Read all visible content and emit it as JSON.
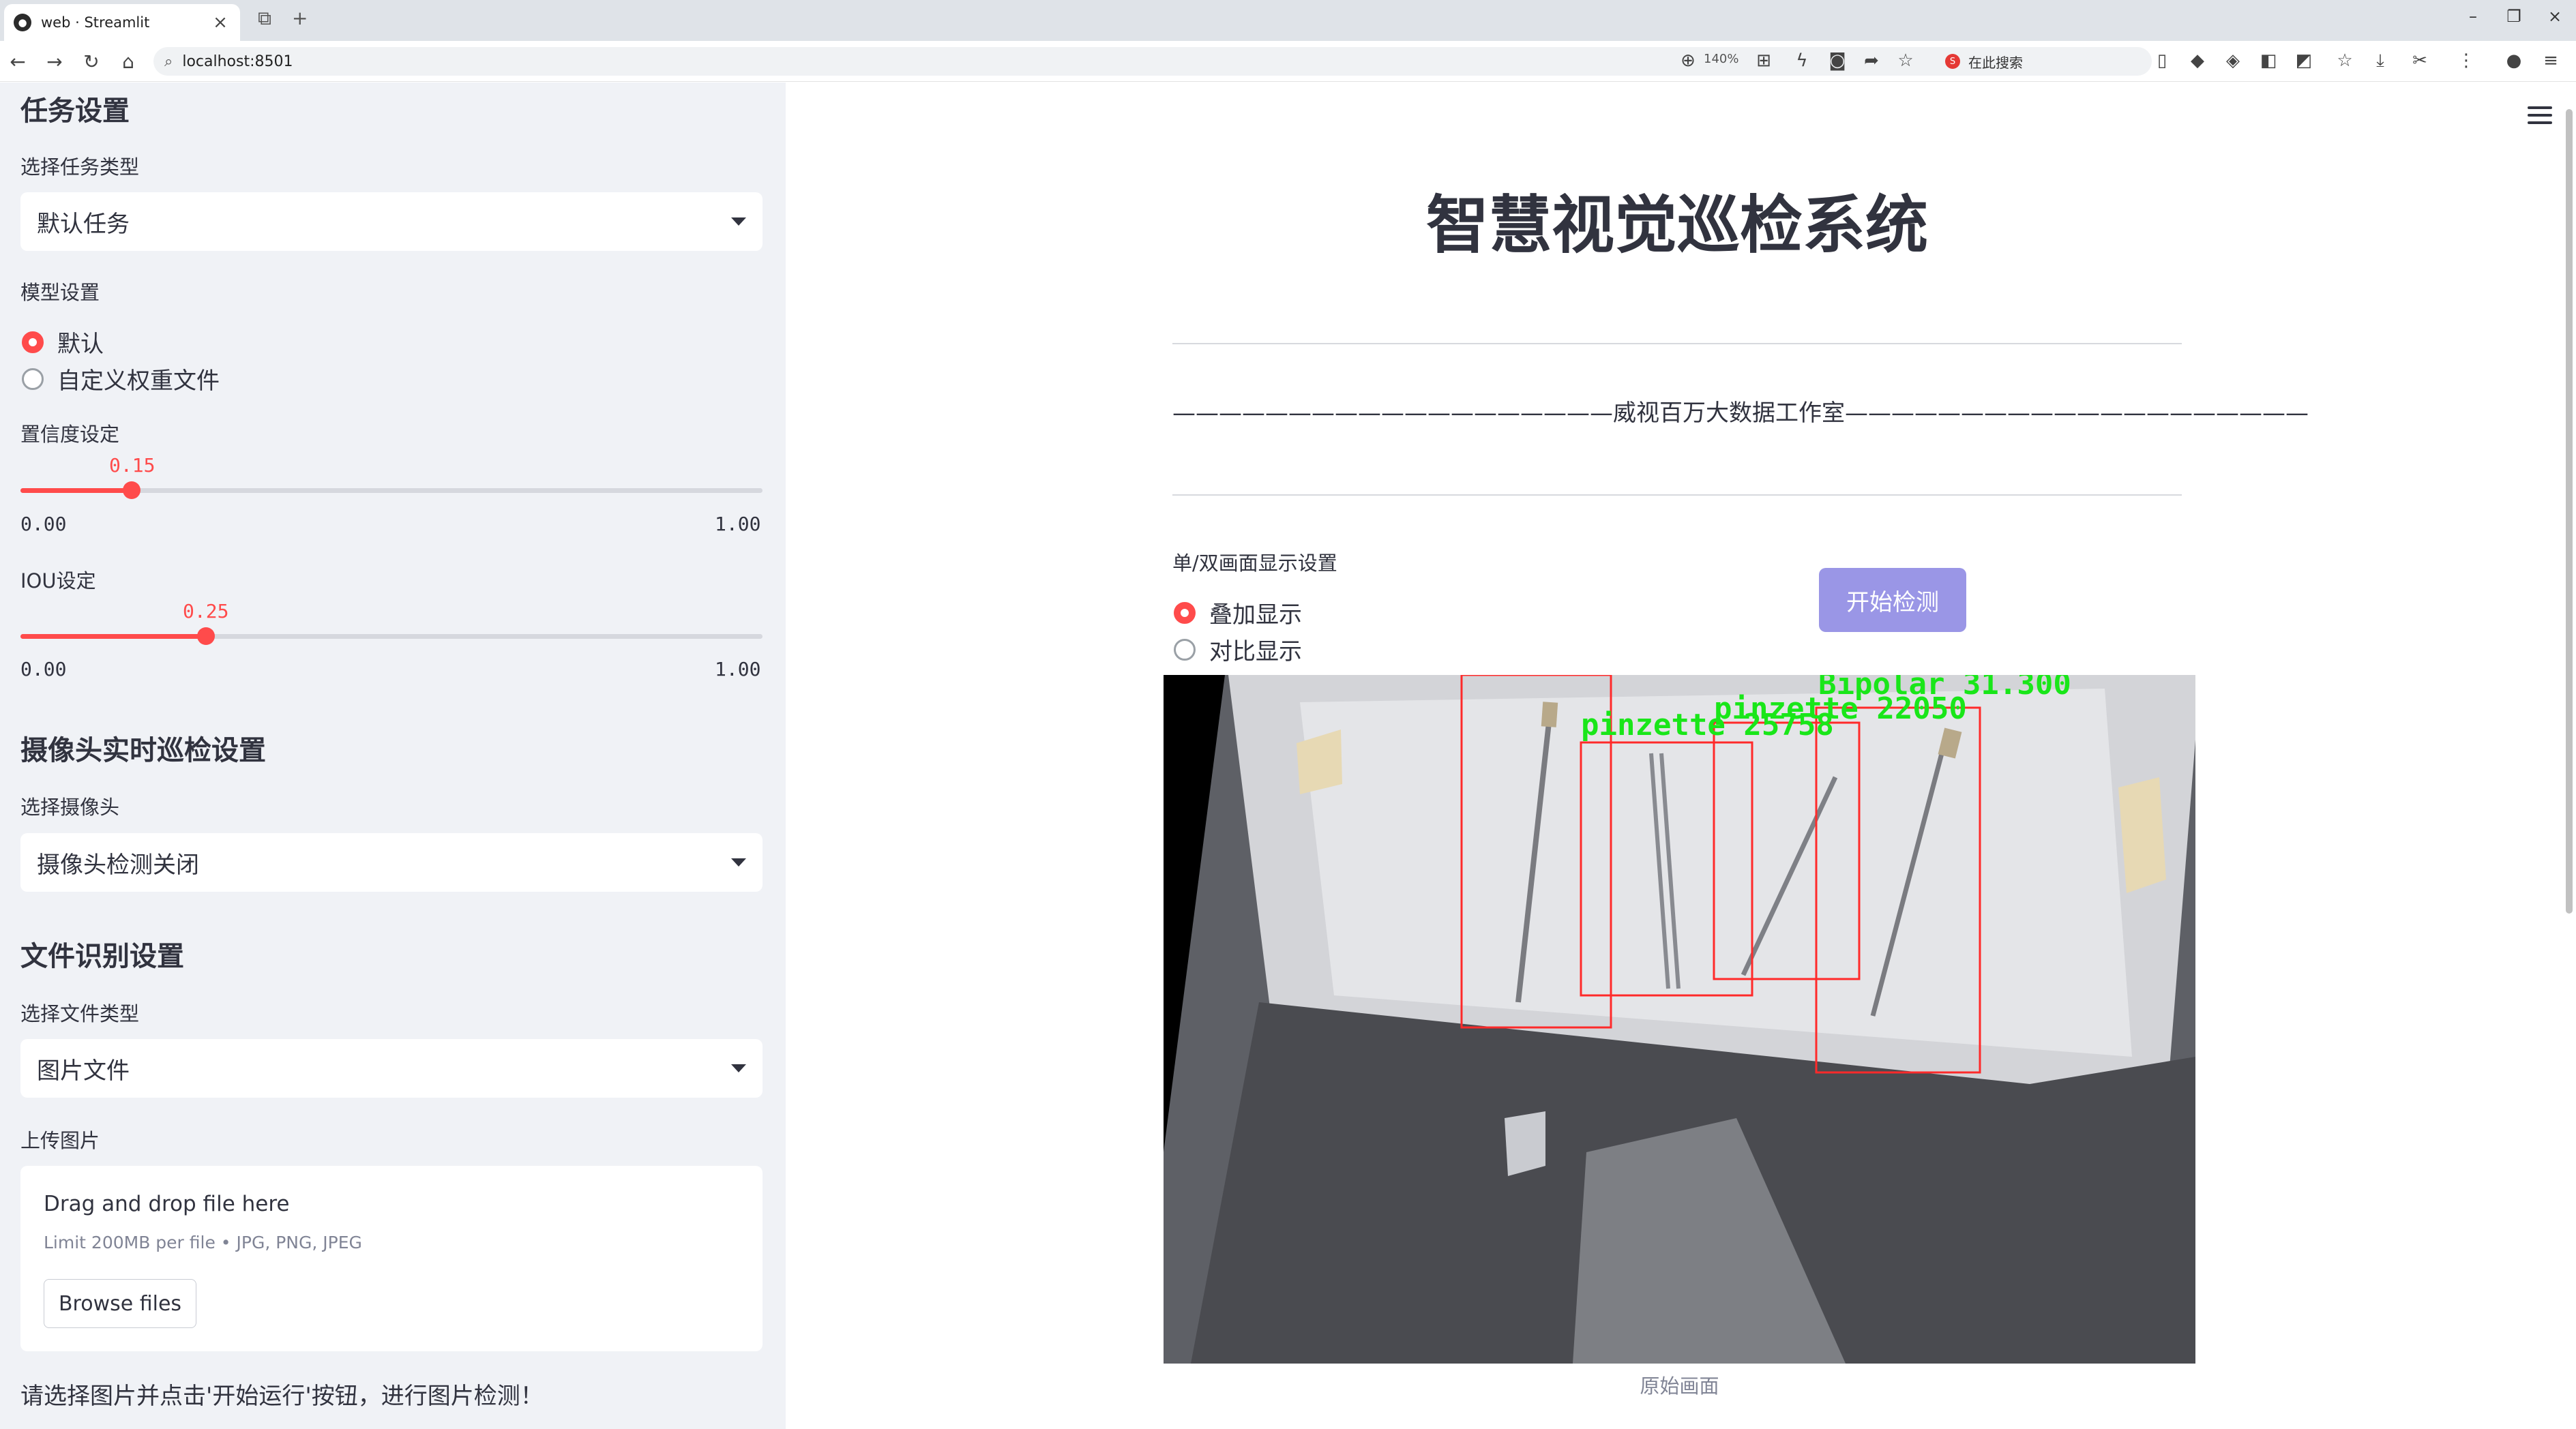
{
  "browser": {
    "tab_title": "web · Streamlit",
    "favicon_glyph": "●",
    "url": "localhost:8501",
    "zoom": "140%",
    "search_placeholder": "在此搜索",
    "search_engine_glyph": "S"
  },
  "sidebar": {
    "task_section": {
      "heading": "任务设置",
      "task_type_label": "选择任务类型",
      "task_type_value": "默认任务",
      "model_label": "模型设置",
      "model_options": [
        "默认",
        "自定义权重文件"
      ],
      "model_selected": 0
    },
    "confidence": {
      "label": "置信度设定",
      "value": "0.15",
      "value_num": 0.15,
      "min": "0.00",
      "max": "1.00"
    },
    "iou": {
      "label": "IOU设定",
      "value": "0.25",
      "value_num": 0.25,
      "min": "0.00",
      "max": "1.00"
    },
    "camera_section": {
      "heading": "摄像头实时巡检设置",
      "camera_label": "选择摄像头",
      "camera_value": "摄像头检测关闭"
    },
    "file_section": {
      "heading": "文件识别设置",
      "file_type_label": "选择文件类型",
      "file_type_value": "图片文件",
      "upload_label": "上传图片",
      "drag_text": "Drag and drop file here",
      "limit_text": "Limit 200MB per file • JPG, PNG, JPEG",
      "browse_label": "Browse files"
    },
    "footer_hint": "请选择图片并点击'开始运行'按钮，进行图片检测！"
  },
  "main": {
    "title": "智慧视觉巡检系统",
    "subtitle": "———————————————————威视百万大数据工作室————————————————————",
    "display_label": "单/双画面显示设置",
    "display_options": [
      "叠加显示",
      "对比显示"
    ],
    "display_selected": 0,
    "start_button": "开始检测",
    "image_caption": "原始画面",
    "detections": [
      {
        "label": "Bipolar 31.300"
      },
      {
        "label": "pinzette 22050"
      },
      {
        "label": "pinzette 25758"
      }
    ]
  },
  "colors": {
    "accent": "#ff4b4b",
    "sidebar_bg": "#f0f2f6",
    "button_bg": "#9a96e6",
    "box_color": "#ff2a2a",
    "label_color": "#19e619"
  }
}
